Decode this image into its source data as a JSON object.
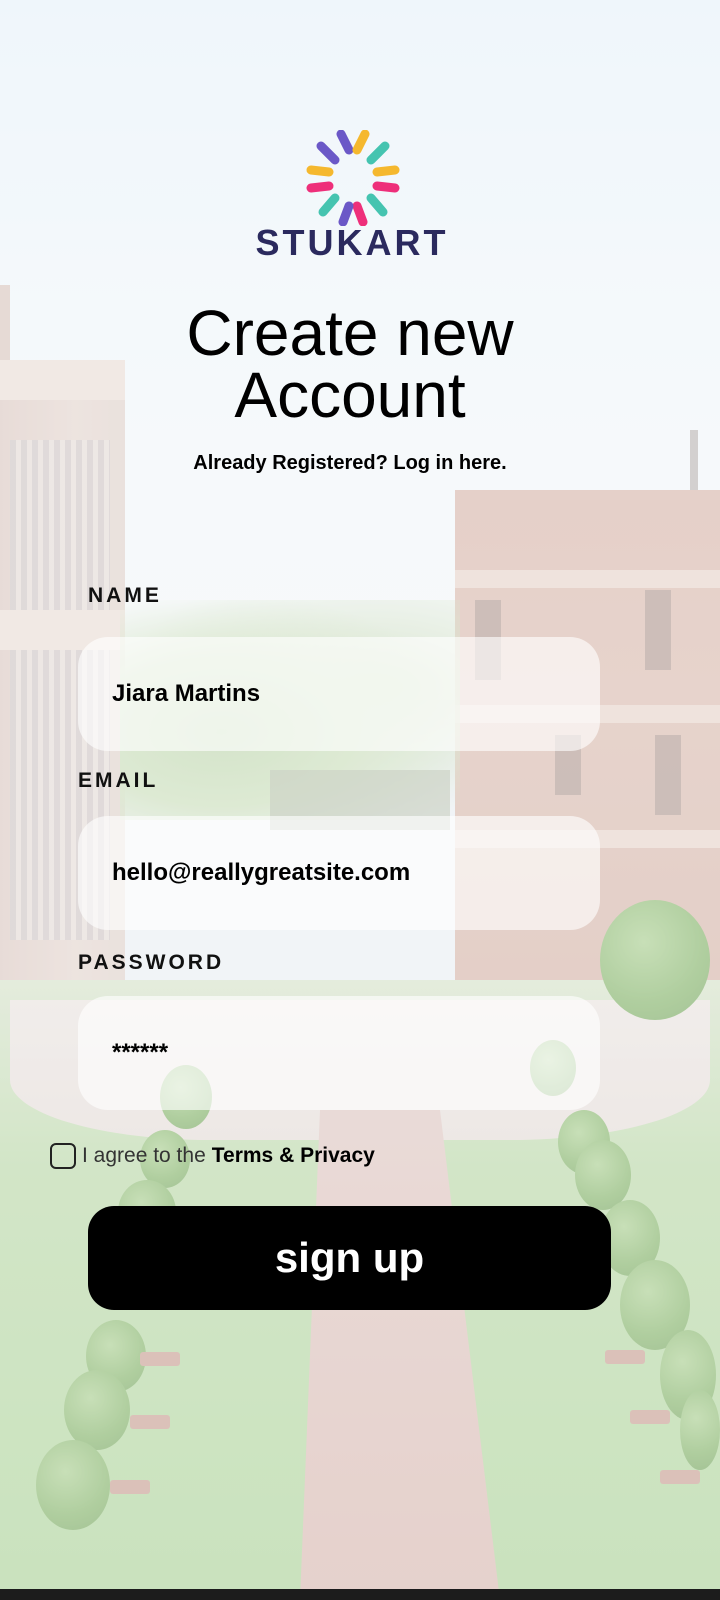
{
  "brand": {
    "name": "STUKART",
    "colors": {
      "name_text": "#2b2a5e",
      "purple": "#6b58c7",
      "pink": "#ee2f7a",
      "teal": "#45c4b0",
      "yellow": "#f5b82e"
    }
  },
  "heading": {
    "line1": "Create new",
    "line2": "Account"
  },
  "login_link": "Already Registered? Log in here.",
  "form": {
    "name": {
      "label": "NAME",
      "value": "Jiara Martins"
    },
    "email": {
      "label": "EMAIL",
      "value": "hello@reallygreatsite.com"
    },
    "password": {
      "label": "PASSWORD",
      "value": "******"
    }
  },
  "agreement": {
    "prefix": "I agree to the",
    "link": "Terms & Privacy",
    "checked": false
  },
  "submit_label": "sign up"
}
